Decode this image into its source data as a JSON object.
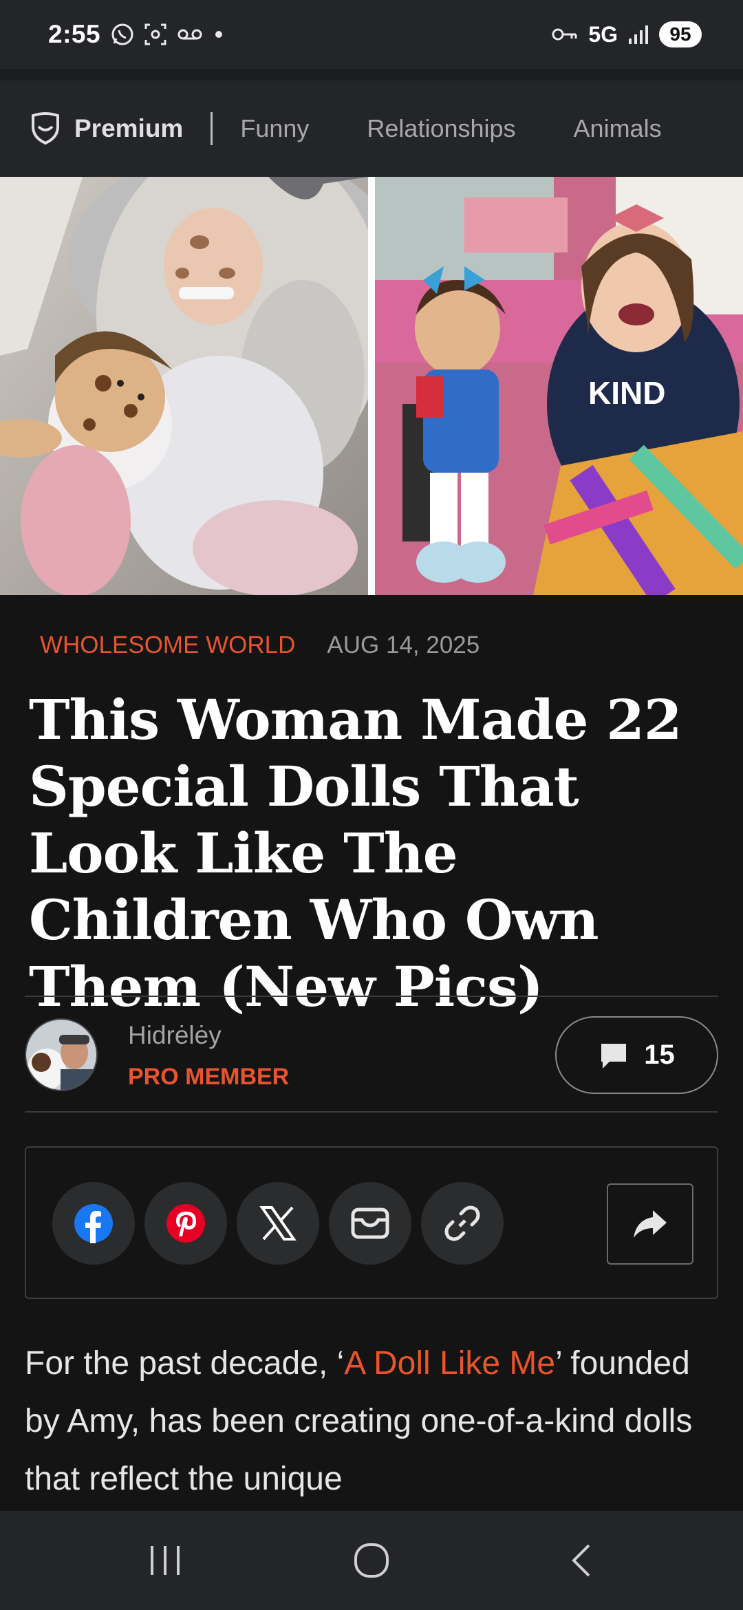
{
  "status_bar": {
    "time": "2:55",
    "network": "5G",
    "battery": "95",
    "icons": [
      "whatsapp-icon",
      "screenshot-icon",
      "voicemail-icon",
      "dot-icon",
      "key-icon",
      "signal-icon"
    ]
  },
  "nav": {
    "premium_label": "Premium",
    "items": [
      "Funny",
      "Relationships",
      "Animals"
    ]
  },
  "article": {
    "category": "WHOLESOME WORLD",
    "date": "AUG 14, 2025",
    "title": "This Woman Made 22 Special Dolls That Look Like The Children Who Own Them (New Pics)"
  },
  "author": {
    "name": "Hidrėlėy",
    "badge": "PRO MEMBER"
  },
  "comments": {
    "count": "15"
  },
  "share": {
    "icons": [
      "facebook-icon",
      "pinterest-icon",
      "x-icon",
      "email-icon",
      "link-icon",
      "forward-icon"
    ]
  },
  "body": {
    "prefix": "For the past decade, ‘",
    "link_text": "A Doll Like Me",
    "suffix": "’ founded by Amy, has been creating one-of-a-kind dolls that reflect the unique"
  },
  "colors": {
    "accent": "#e8552d",
    "background": "#141415",
    "bar": "#242528",
    "facebook": "#1877f2",
    "pinterest": "#e60023"
  }
}
